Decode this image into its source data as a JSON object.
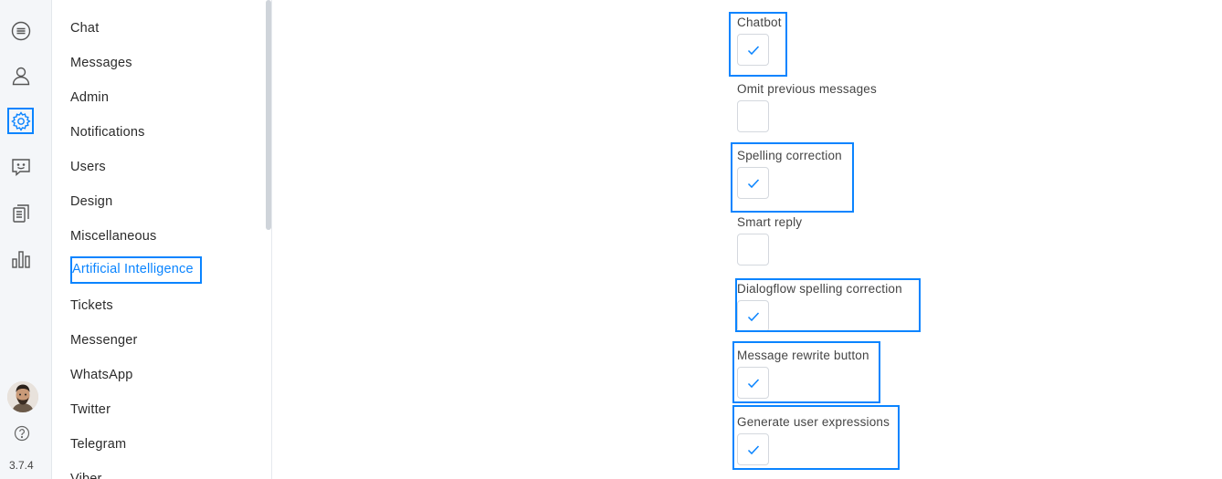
{
  "rail": {
    "icons": [
      "chat-icon",
      "user-icon",
      "gear-icon",
      "chatbot-icon",
      "documents-icon",
      "bar-chart-icon",
      "help-icon"
    ],
    "version": "3.7.4",
    "accent": "#0a84ff"
  },
  "nav": {
    "items": [
      {
        "label": "Chat"
      },
      {
        "label": "Messages"
      },
      {
        "label": "Admin"
      },
      {
        "label": "Notifications"
      },
      {
        "label": "Users"
      },
      {
        "label": "Design"
      },
      {
        "label": "Miscellaneous"
      },
      {
        "label": "Artificial Intelligence"
      },
      {
        "label": "Tickets"
      },
      {
        "label": "Messenger"
      },
      {
        "label": "WhatsApp"
      },
      {
        "label": "Twitter"
      },
      {
        "label": "Telegram"
      },
      {
        "label": "Viber"
      }
    ],
    "active": "Artificial Intelligence"
  },
  "settings": [
    {
      "label": "Chatbot",
      "checked": true
    },
    {
      "label": "Omit previous messages",
      "checked": false
    },
    {
      "label": "Spelling correction",
      "checked": true
    },
    {
      "label": "Smart reply",
      "checked": false
    },
    {
      "label": "Dialogflow spelling correction",
      "checked": true
    },
    {
      "label": "Message rewrite button",
      "checked": true
    },
    {
      "label": "Generate user expressions",
      "checked": true
    }
  ]
}
